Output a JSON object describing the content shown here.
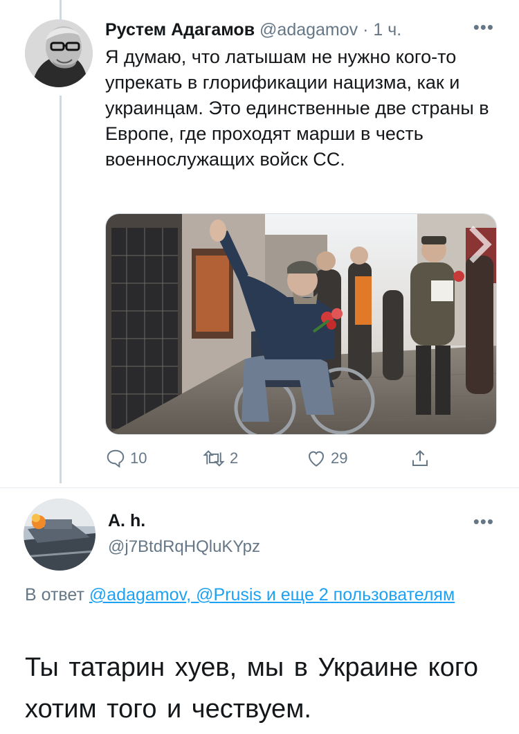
{
  "tweet1": {
    "author_name": "Рустем Адагамов",
    "handle": "@adagamov",
    "separator": "·",
    "time": "1 ч.",
    "more": "•••",
    "text": "Я думаю, что латышам не нужно кого-то упрекать в глорификации нацизма, как и украинцам. Это единственные две страны в Европе, где проходят марши в честь военнослужащих войск СС.",
    "actions": {
      "reply_count": "10",
      "retweet_count": "2",
      "like_count": "29",
      "reply_icon": "reply-icon",
      "retweet_icon": "retweet-icon",
      "like_icon": "heart-icon",
      "share_icon": "share-icon"
    }
  },
  "tweet2": {
    "author_name": "A. h.",
    "handle": "@j7BtdRqHQluKYpz",
    "more": "•••",
    "reply_prefix": "В ответ",
    "reply_mentions": "@adagamov, @Prusis и еще 2 пользователям",
    "text": "Ты татарин хуев, мы в Украине кого хотим того и чествуем."
  },
  "colors": {
    "accent": "#1da1f2",
    "muted": "#657786",
    "thread_line": "#cfd9de"
  }
}
